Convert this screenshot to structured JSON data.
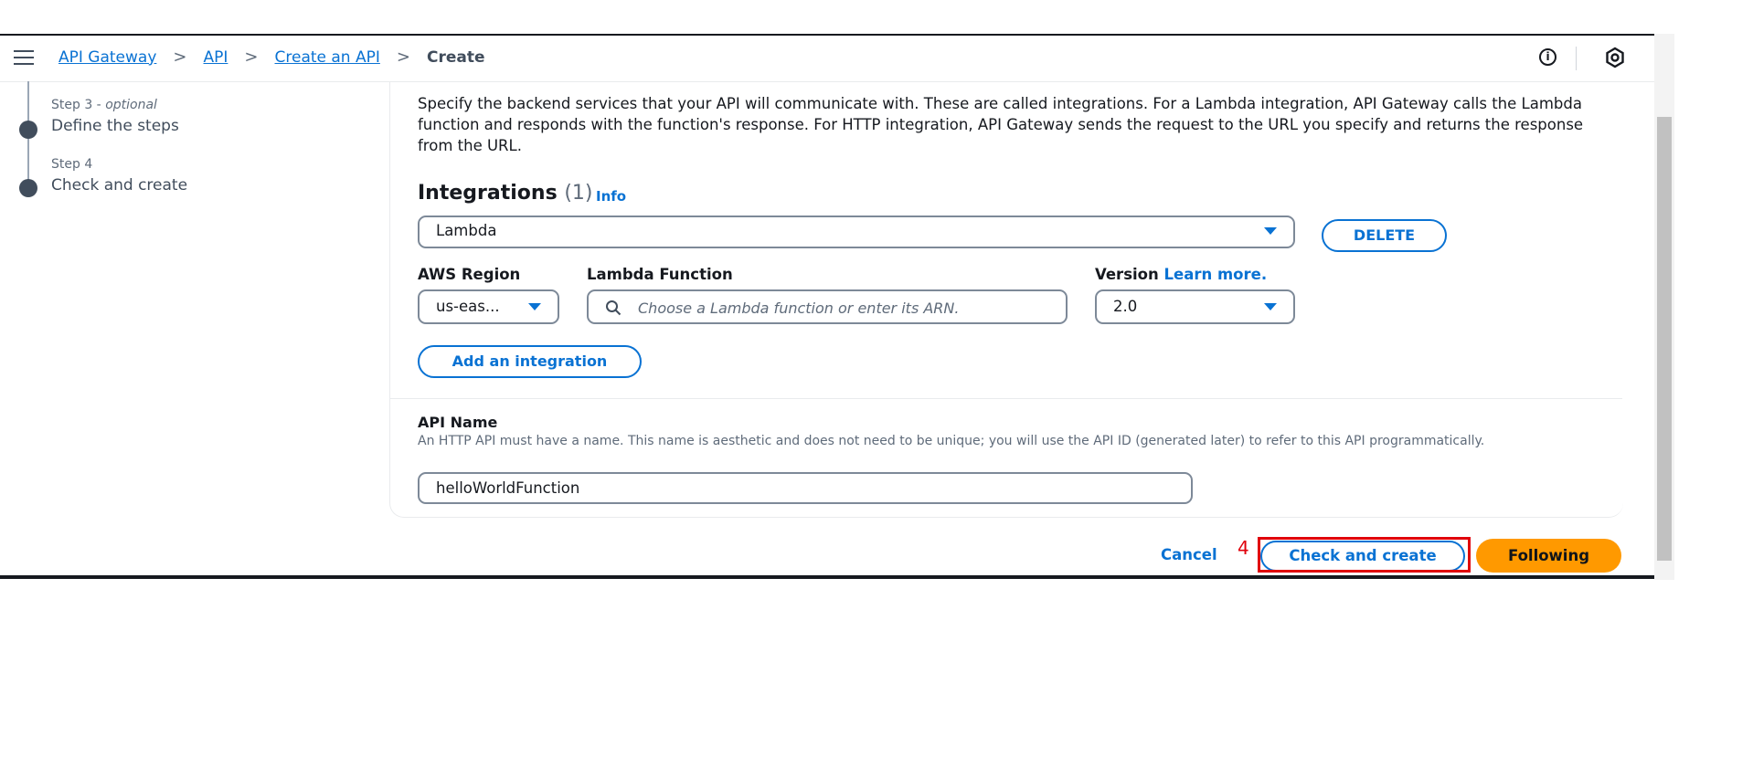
{
  "breadcrumbs": [
    {
      "label": "API Gateway"
    },
    {
      "label": "API"
    },
    {
      "label": "Create an API"
    }
  ],
  "breadcrumb_current": "Create",
  "header": {
    "info_icon_glyph": "i"
  },
  "steps": [
    {
      "number_prefix": "Step 3 - ",
      "optional_label": "optional",
      "title": "Define the steps"
    },
    {
      "number_prefix": "Step 4",
      "optional_label": "",
      "title": "Check and create"
    }
  ],
  "main": {
    "description": "Specify the backend services that your API will communicate with. These are called integrations. For a Lambda integration, API Gateway calls the Lambda function and responds with the function's response. For HTTP integration, API Gateway sends the request to the URL you specify and returns the response from the URL.",
    "integrations": {
      "title": "Integrations",
      "count": "(1)",
      "info_label": "Info",
      "type_value": "Lambda",
      "delete_label": "DELETE",
      "region_label": "AWS Region",
      "region_value": "us-eas...",
      "function_label": "Lambda Function",
      "function_placeholder": "Choose a Lambda function or enter its ARN.",
      "version_label": "Version",
      "learn_more": "Learn more.",
      "version_value": "2.0",
      "add_label": "Add an integration"
    },
    "api_name": {
      "label": "API Name",
      "help": "An HTTP API must have a name. This name is aesthetic and does not need to be unique; you will use the API ID (generated later) to refer to this API programmatically.",
      "value": "helloWorldFunction"
    }
  },
  "footer": {
    "cancel_label": "Cancel",
    "annotation_number": "4",
    "check_create_label": "Check and create",
    "following_label": "Following"
  },
  "colors": {
    "accent": "#0972d3",
    "primary_button": "#ff9900",
    "annotation": "#e0000b"
  }
}
